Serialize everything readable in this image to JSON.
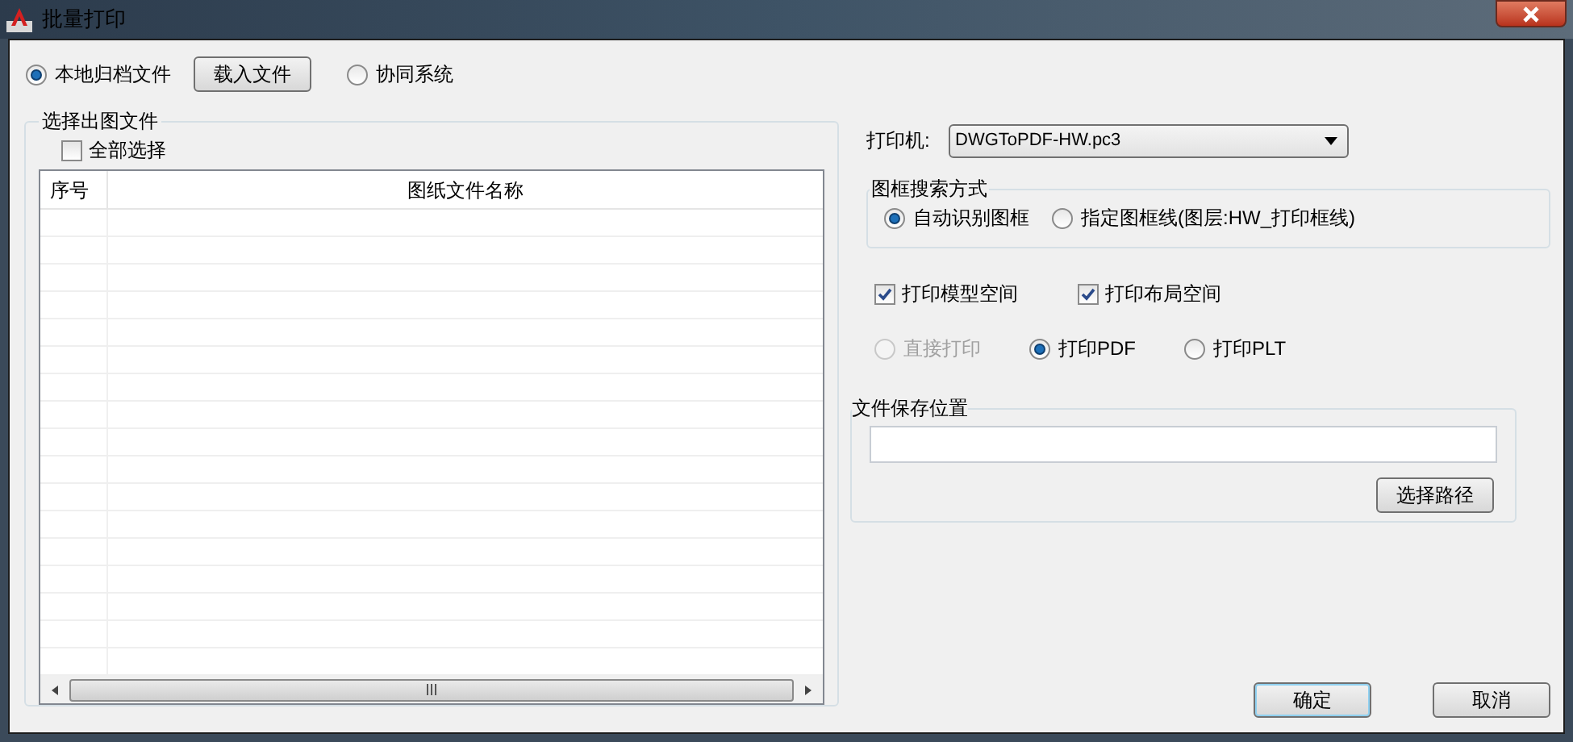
{
  "window": {
    "title": "批量打印"
  },
  "source_options": [
    {
      "label": "本地归档文件",
      "selected": true
    },
    {
      "label": "协同系统",
      "selected": false
    }
  ],
  "load_button": "载入文件",
  "file_group": {
    "title": "选择出图文件",
    "select_all": {
      "label": "全部选择",
      "checked": false
    },
    "columns": [
      "序号",
      "图纸文件名称"
    ]
  },
  "printer": {
    "label": "打印机:",
    "value": "DWGToPDF-HW.pc3"
  },
  "frame_search": {
    "title": "图框搜索方式",
    "options": [
      {
        "label": "自动识别图框",
        "selected": true
      },
      {
        "label": "指定图框线(图层:HW_打印框线)",
        "selected": false
      }
    ]
  },
  "space_options": [
    {
      "label": "打印模型空间",
      "checked": true
    },
    {
      "label": "打印布局空间",
      "checked": true
    }
  ],
  "output_options": [
    {
      "label": "直接打印",
      "selected": false,
      "disabled": true
    },
    {
      "label": "打印PDF",
      "selected": true,
      "disabled": false
    },
    {
      "label": "打印PLT",
      "selected": false,
      "disabled": false
    }
  ],
  "save_location": {
    "title": "文件保存位置",
    "browse_button": "选择路径"
  },
  "buttons": [
    {
      "label": "确定",
      "kind": "default"
    },
    {
      "label": "取消",
      "kind": "normal"
    }
  ]
}
